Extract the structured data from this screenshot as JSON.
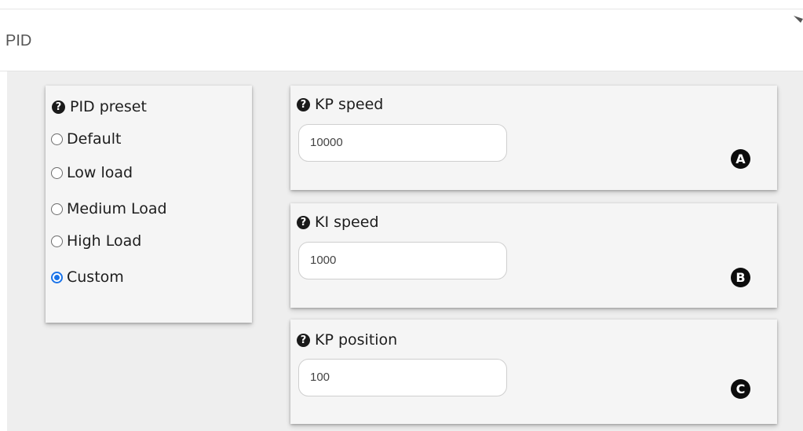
{
  "panel": {
    "title": "PID"
  },
  "preset": {
    "label": "PID preset",
    "options": [
      "Default",
      "Low load",
      "Medium Load",
      "High Load",
      "Custom"
    ],
    "selected": "Custom"
  },
  "fields": [
    {
      "label": "KP speed",
      "value": "10000",
      "marker": "A"
    },
    {
      "label": "KI speed",
      "value": "1000",
      "marker": "B"
    },
    {
      "label": "KP position",
      "value": "100",
      "marker": "C"
    }
  ],
  "icons": {
    "help": "question-circle-icon",
    "marker": "circled-letter"
  },
  "colors": {
    "accent": "#1a73e8",
    "background": "#eeeeee",
    "card": "#f5f5f5"
  }
}
